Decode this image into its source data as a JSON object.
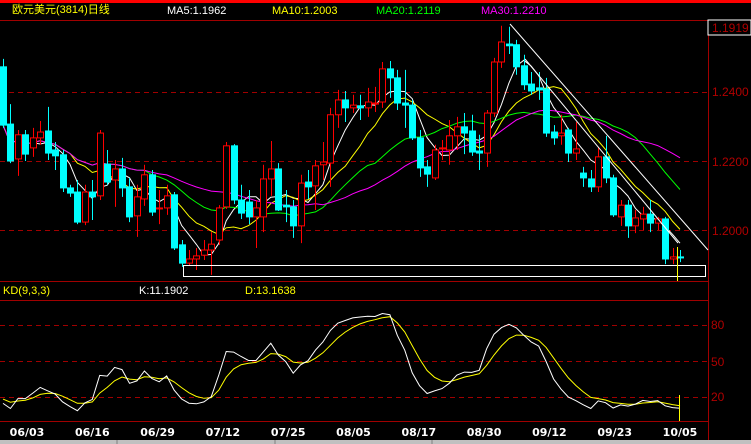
{
  "header": {
    "title": "欧元美元(3814)日线",
    "ma5": "MA5:1.1962",
    "ma10": "MA10:1.2003",
    "ma20": "MA20:1.2119",
    "ma30": "MA30:1.2210"
  },
  "price_axis": {
    "current_price": "1.1919",
    "ticks": [
      "1.2400",
      "1.2200",
      "1.2000"
    ]
  },
  "kd_header": {
    "name": "KD(9,3,3)",
    "k": "K:11.1902",
    "d": "D:13.1638"
  },
  "kd_axis": {
    "ticks": [
      "80",
      "50",
      "20"
    ]
  },
  "colors": {
    "up": "#ff0000",
    "down": "#00ffff",
    "ma5": "#ffffff",
    "ma10": "#ffff00",
    "ma20": "#00ff00",
    "ma30": "#ff00ff",
    "grid": "#a00000",
    "k": "#ffffff",
    "d": "#ffff00"
  },
  "chart_data": [
    {
      "type": "candlestick",
      "title": "欧元美元(3814)日线",
      "ylim": [
        1.185,
        1.262
      ],
      "grid_levels": [
        1.24,
        1.22,
        1.2
      ],
      "x_tick_labels": [
        "06/03",
        "06/16",
        "06/29",
        "07/12",
        "07/25",
        "08/05",
        "08/17",
        "08/30",
        "09/12",
        "09/23",
        "10/05"
      ],
      "ohlc_fields": [
        "open",
        "close",
        "high",
        "low"
      ],
      "candles": [
        [
          1.2473,
          1.2304,
          1.2496,
          1.2296
        ],
        [
          1.2307,
          1.22,
          1.2365,
          1.2194
        ],
        [
          1.2206,
          1.2276,
          1.229,
          1.2157
        ],
        [
          1.2276,
          1.222,
          1.229,
          1.22
        ],
        [
          1.2238,
          1.2267,
          1.2296,
          1.2212
        ],
        [
          1.2267,
          1.2284,
          1.2316,
          1.2247
        ],
        [
          1.2287,
          1.2223,
          1.2357,
          1.2203
        ],
        [
          1.2232,
          1.2215,
          1.2255,
          1.2174
        ],
        [
          1.2218,
          1.2122,
          1.2232,
          1.211
        ],
        [
          1.2122,
          1.2107,
          1.2131,
          1.2096
        ],
        [
          1.211,
          1.2023,
          1.2145,
          1.2017
        ],
        [
          1.2023,
          1.211,
          1.2131,
          1.2014
        ],
        [
          1.211,
          1.2096,
          1.2145,
          1.2029
        ],
        [
          1.2099,
          1.2281,
          1.229,
          1.2087
        ],
        [
          1.2191,
          1.2139,
          1.2232,
          1.2131
        ],
        [
          1.2145,
          1.2177,
          1.2203,
          1.2067
        ],
        [
          1.2177,
          1.2122,
          1.2209,
          1.2096
        ],
        [
          1.2125,
          1.2038,
          1.2151,
          1.2023
        ],
        [
          1.2041,
          1.2096,
          1.2131,
          1.198
        ],
        [
          1.209,
          1.216,
          1.2189,
          1.207
        ],
        [
          1.216,
          1.2052,
          1.2174,
          1.2041
        ],
        [
          1.2061,
          1.2064,
          1.2116,
          1.2017
        ],
        [
          1.2064,
          1.2099,
          1.2131,
          1.2044
        ],
        [
          1.2102,
          1.1948,
          1.211,
          1.1942
        ],
        [
          1.1957,
          1.1904,
          1.1971,
          1.1893
        ],
        [
          1.1904,
          1.1916,
          1.1942,
          1.1896
        ],
        [
          1.1916,
          1.1925,
          1.1948,
          1.1884
        ],
        [
          1.1927,
          1.1942,
          1.1971,
          1.1913
        ],
        [
          1.1942,
          1.1959,
          1.1994,
          1.187
        ],
        [
          1.1971,
          1.2064,
          1.2072,
          1.1957
        ],
        [
          1.2067,
          1.2244,
          1.2255,
          1.2061
        ],
        [
          1.2244,
          1.2087,
          1.2249,
          1.2075
        ],
        [
          1.2087,
          1.2049,
          1.2131,
          1.2032
        ],
        [
          1.2081,
          1.2038,
          1.2116,
          1.2017
        ],
        [
          1.2038,
          1.2064,
          1.2087,
          1.1948
        ],
        [
          1.2038,
          1.2148,
          1.2189,
          1.1994
        ],
        [
          1.2148,
          1.2177,
          1.2258,
          1.2099
        ],
        [
          1.2177,
          1.2058,
          1.2194,
          1.2055
        ],
        [
          1.2072,
          1.2067,
          1.2116,
          1.2023
        ],
        [
          1.2067,
          1.2012,
          1.2087,
          1.1977
        ],
        [
          1.2012,
          1.2136,
          1.216,
          1.1962
        ],
        [
          1.2139,
          1.2125,
          1.2174,
          1.209
        ],
        [
          1.2128,
          1.2186,
          1.2203,
          1.2058
        ],
        [
          1.2189,
          1.2197,
          1.2255,
          1.2145
        ],
        [
          1.2194,
          1.2334,
          1.2354,
          1.2125
        ],
        [
          1.2334,
          1.2377,
          1.2406,
          1.2296
        ],
        [
          1.2377,
          1.2354,
          1.2403,
          1.2313
        ],
        [
          1.2354,
          1.2362,
          1.2392,
          1.2339
        ],
        [
          1.236,
          1.2354,
          1.2392,
          1.2319
        ],
        [
          1.2354,
          1.2371,
          1.2412,
          1.2328
        ],
        [
          1.2365,
          1.2368,
          1.2415,
          1.2342
        ],
        [
          1.2371,
          1.2467,
          1.2487,
          1.2354
        ],
        [
          1.2467,
          1.2441,
          1.249,
          1.2383
        ],
        [
          1.2441,
          1.2368,
          1.2464,
          1.2348
        ],
        [
          1.2368,
          1.2362,
          1.2464,
          1.2296
        ],
        [
          1.2362,
          1.2267,
          1.2377,
          1.2261
        ],
        [
          1.2267,
          1.218,
          1.229,
          1.2154
        ],
        [
          1.2183,
          1.2162,
          1.2203,
          1.2125
        ],
        [
          1.2151,
          1.2232,
          1.2247,
          1.2145
        ],
        [
          1.2235,
          1.2238,
          1.2261,
          1.2203
        ],
        [
          1.2232,
          1.2273,
          1.2319,
          1.2189
        ],
        [
          1.2273,
          1.2299,
          1.2328,
          1.2232
        ],
        [
          1.2299,
          1.2281,
          1.2339,
          1.222
        ],
        [
          1.2287,
          1.2226,
          1.2334,
          1.2215
        ],
        [
          1.2229,
          1.2223,
          1.2276,
          1.2174
        ],
        [
          1.2223,
          1.2339,
          1.2348,
          1.2183
        ],
        [
          1.2339,
          1.2487,
          1.2499,
          1.2328
        ],
        [
          1.2487,
          1.2545,
          1.2592,
          1.247
        ],
        [
          1.2539,
          1.2534,
          1.2589,
          1.251
        ],
        [
          1.2537,
          1.2473,
          1.2551,
          1.245
        ],
        [
          1.2476,
          1.2421,
          1.2508,
          1.2406
        ],
        [
          1.2423,
          1.2403,
          1.2458,
          1.2392
        ],
        [
          1.2412,
          1.2406,
          1.2458,
          1.2377
        ],
        [
          1.2409,
          1.2281,
          1.2441,
          1.227
        ],
        [
          1.2284,
          1.2267,
          1.2304,
          1.2247
        ],
        [
          1.2273,
          1.2281,
          1.2334,
          1.2247
        ],
        [
          1.229,
          1.2223,
          1.2296,
          1.2197
        ],
        [
          1.2223,
          1.2235,
          1.2313,
          1.2203
        ],
        [
          1.2165,
          1.2151,
          1.2183,
          1.2125
        ],
        [
          1.2148,
          1.2125,
          1.2174,
          1.211
        ],
        [
          1.2125,
          1.2212,
          1.2241,
          1.211
        ],
        [
          1.2212,
          1.2151,
          1.2273,
          1.2136
        ],
        [
          1.2151,
          1.2044,
          1.216,
          1.2038
        ],
        [
          1.2038,
          1.2072,
          1.2087,
          1.2012
        ],
        [
          1.2072,
          1.2012,
          1.2087,
          1.1977
        ],
        [
          1.2012,
          1.2035,
          1.2058,
          1.1991
        ],
        [
          1.2032,
          1.2046,
          1.2067,
          1.2
        ],
        [
          1.2046,
          1.202,
          1.2087,
          1.1994
        ],
        [
          1.202,
          1.2032,
          1.2038,
          1.2
        ],
        [
          1.2032,
          1.1916,
          1.2038,
          1.1901
        ],
        [
          1.1916,
          1.1922,
          1.1948,
          1.1901
        ],
        [
          1.1922,
          1.1919,
          1.1942,
          1.1907
        ]
      ],
      "moving_averages": [
        5,
        10,
        20,
        30
      ],
      "trendlines": [
        {
          "from": [
            67,
            1.2592
          ],
          "to": [
            96,
            1.193
          ]
        },
        {
          "from": [
            69,
            1.2497
          ],
          "to": [
            91,
            1.195
          ]
        }
      ]
    },
    {
      "type": "line",
      "title": "KD(9,3,3)",
      "ylim": [
        0,
        100
      ],
      "grid_levels": [
        80,
        50,
        20
      ],
      "series": [
        {
          "name": "K",
          "last": 11.1902
        },
        {
          "name": "D",
          "last": 13.1638
        }
      ]
    }
  ]
}
